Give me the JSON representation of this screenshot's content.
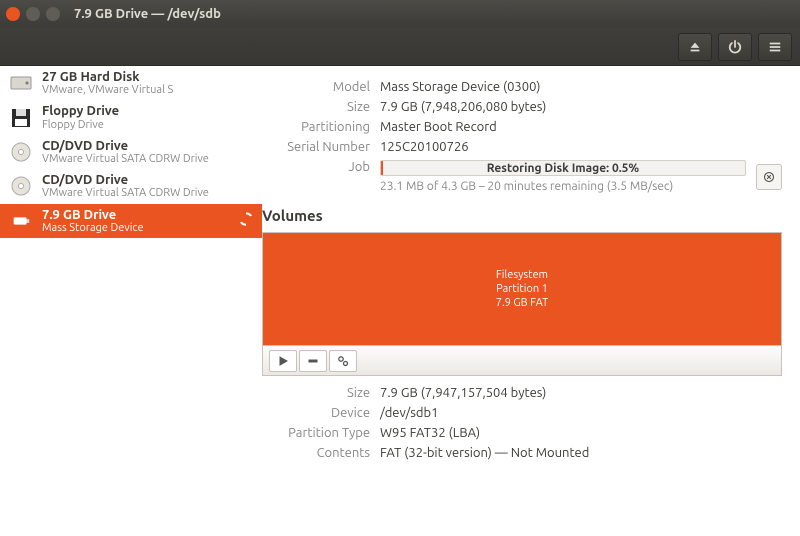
{
  "window": {
    "title": "7.9 GB Drive — /dev/sdb"
  },
  "sidebar": {
    "items": [
      {
        "title": "27 GB Hard Disk",
        "subtitle": "VMware, VMware Virtual S",
        "icon": "hdd"
      },
      {
        "title": "Floppy Drive",
        "subtitle": "Floppy Drive",
        "icon": "floppy"
      },
      {
        "title": "CD/DVD Drive",
        "subtitle": "VMware Virtual SATA CDRW Drive",
        "icon": "cd"
      },
      {
        "title": "CD/DVD Drive",
        "subtitle": "VMware Virtual SATA CDRW Drive",
        "icon": "cd"
      },
      {
        "title": "7.9 GB Drive",
        "subtitle": "Mass Storage Device",
        "icon": "usb",
        "selected": true,
        "busy": true
      }
    ]
  },
  "info": {
    "model_label": "Model",
    "model": "Mass Storage Device (0300)",
    "size_label": "Size",
    "size": "7.9 GB (7,948,206,080 bytes)",
    "part_label": "Partitioning",
    "part": "Master Boot Record",
    "serial_label": "Serial Number",
    "serial": "125C20100726",
    "job_label": "Job",
    "job_text": "Restoring Disk Image: 0.5%",
    "job_progress_percent": 0.5,
    "job_detail": "23.1 MB of 4.3 GB – 20 minutes remaining (3.5 MB/sec)"
  },
  "volumes": {
    "heading": "Volumes",
    "partition": {
      "line1": "Filesystem",
      "line2": "Partition 1",
      "line3": "7.9 GB FAT"
    },
    "details": {
      "size_label": "Size",
      "size": "7.9 GB (7,947,157,504 bytes)",
      "device_label": "Device",
      "device": "/dev/sdb1",
      "ptype_label": "Partition Type",
      "ptype": "W95 FAT32 (LBA)",
      "contents_label": "Contents",
      "contents": "FAT (32-bit version) — Not Mounted"
    }
  }
}
